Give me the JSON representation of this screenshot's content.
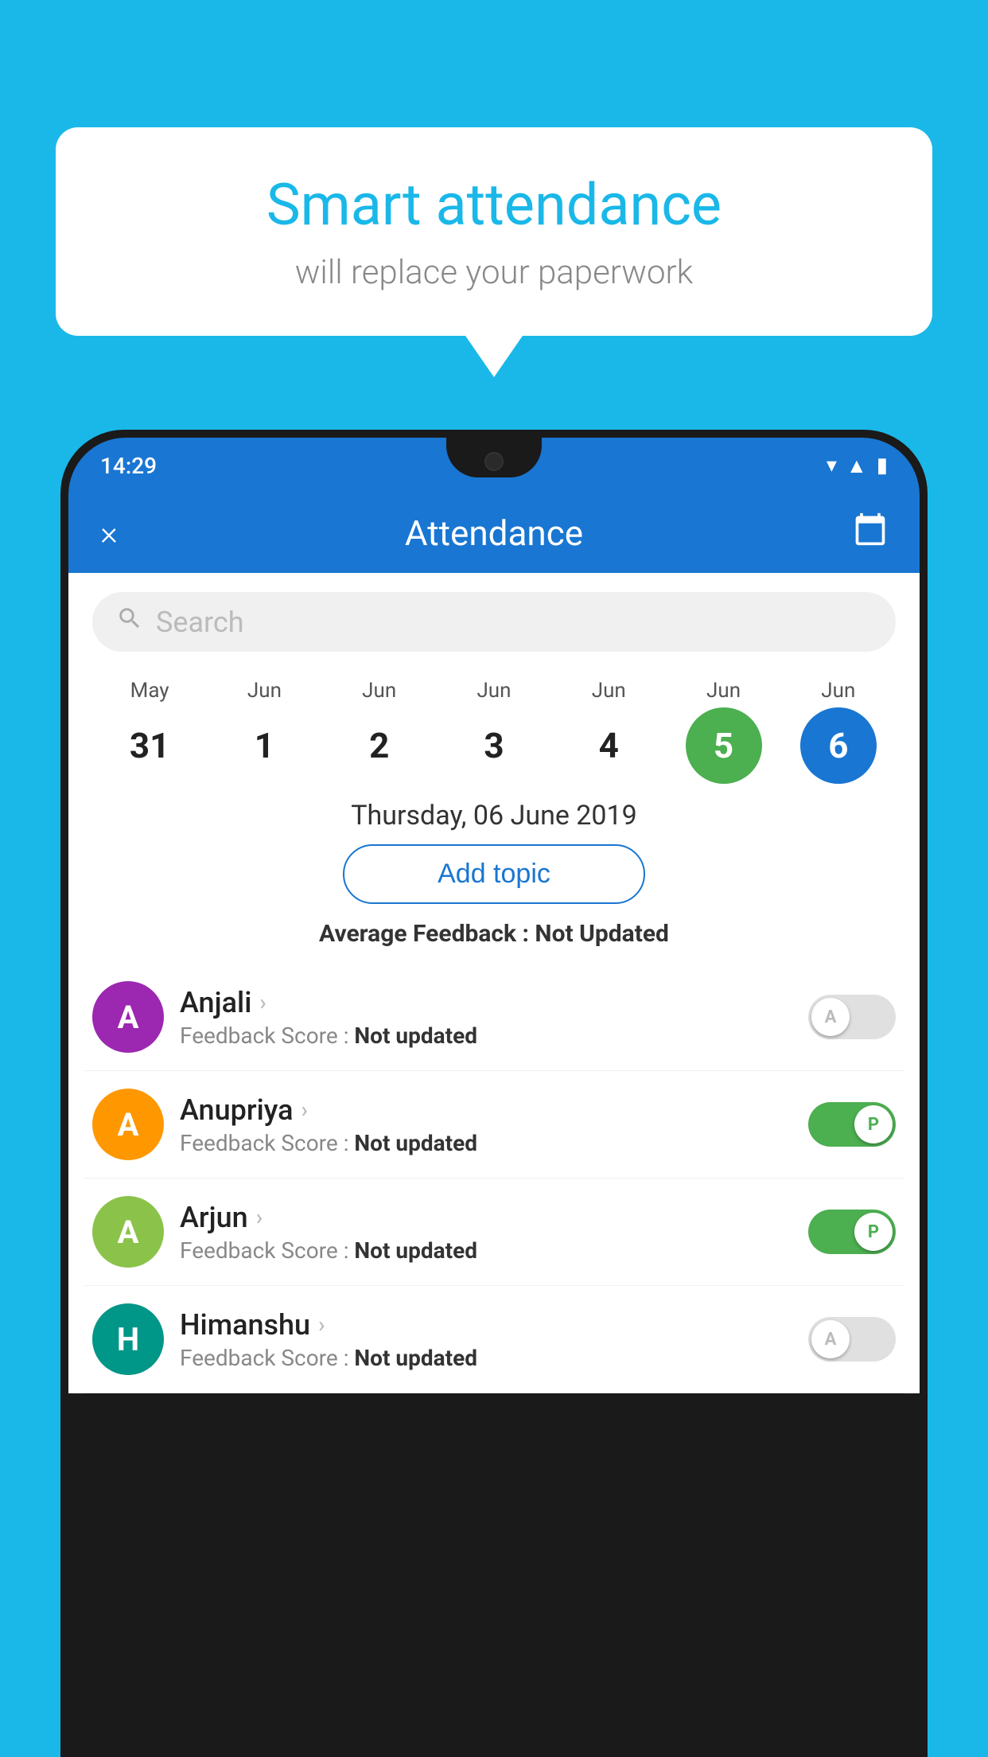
{
  "background_color": "#1ab8e8",
  "bubble": {
    "title": "Smart attendance",
    "subtitle": "will replace your paperwork"
  },
  "status_bar": {
    "time": "14:29",
    "icons": [
      "wifi",
      "signal",
      "battery"
    ]
  },
  "app_header": {
    "title": "Attendance",
    "close_label": "×",
    "calendar_icon": "📅"
  },
  "search": {
    "placeholder": "Search"
  },
  "calendar": {
    "dates": [
      {
        "month": "May",
        "day": "31",
        "state": "normal"
      },
      {
        "month": "Jun",
        "day": "1",
        "state": "normal"
      },
      {
        "month": "Jun",
        "day": "2",
        "state": "normal"
      },
      {
        "month": "Jun",
        "day": "3",
        "state": "normal"
      },
      {
        "month": "Jun",
        "day": "4",
        "state": "normal"
      },
      {
        "month": "Jun",
        "day": "5",
        "state": "today"
      },
      {
        "month": "Jun",
        "day": "6",
        "state": "selected"
      }
    ],
    "selected_date_label": "Thursday, 06 June 2019"
  },
  "add_topic_button": "Add topic",
  "average_feedback": {
    "label": "Average Feedback : ",
    "value": "Not Updated"
  },
  "students": [
    {
      "name": "Anjali",
      "avatar_letter": "A",
      "avatar_color": "purple",
      "feedback_label": "Feedback Score : ",
      "feedback_value": "Not updated",
      "toggle_state": "off",
      "toggle_label": "A"
    },
    {
      "name": "Anupriya",
      "avatar_letter": "A",
      "avatar_color": "orange",
      "feedback_label": "Feedback Score : ",
      "feedback_value": "Not updated",
      "toggle_state": "on",
      "toggle_label": "P"
    },
    {
      "name": "Arjun",
      "avatar_letter": "A",
      "avatar_color": "green",
      "feedback_label": "Feedback Score : ",
      "feedback_value": "Not updated",
      "toggle_state": "on",
      "toggle_label": "P"
    },
    {
      "name": "Himanshu",
      "avatar_letter": "H",
      "avatar_color": "teal",
      "feedback_label": "Feedback Score : ",
      "feedback_value": "Not updated",
      "toggle_state": "off",
      "toggle_label": "A"
    }
  ]
}
